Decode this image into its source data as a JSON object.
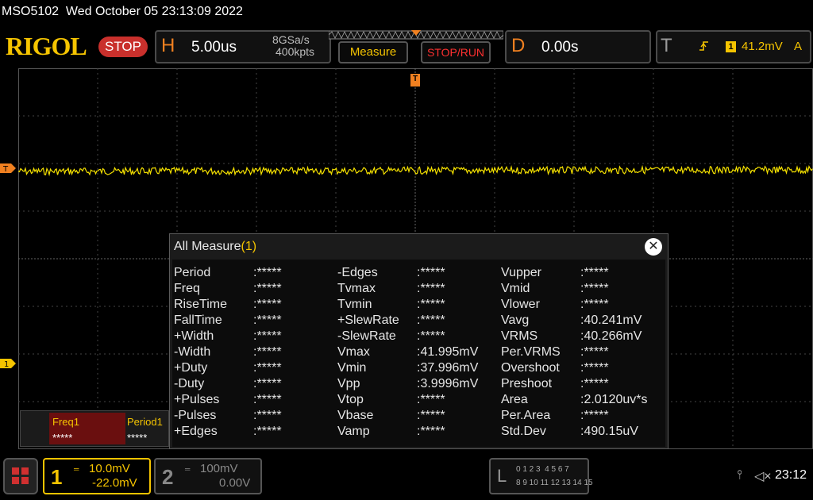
{
  "titlebar": {
    "title": "MSO5102  Wed October 05 23:13:09 2022"
  },
  "toolbar": {
    "logo": "RIGOL",
    "run_state": "STOP",
    "horizontal": {
      "letter": "H",
      "timebase": "5.00us",
      "sample_rate": "8GSa/s",
      "memory_depth": "400kpts"
    },
    "measure_label": "Measure",
    "stoprun_label": "STOP/RUN",
    "delay": {
      "letter": "D",
      "value": "0.00s"
    },
    "trigger": {
      "letter": "T",
      "source": "1",
      "level": "41.2mV",
      "mode": "A",
      "slope_icon": "rising-edge-icon"
    }
  },
  "markers": {
    "trigger_position": "T",
    "trigger_level": "T",
    "ch1_ground": "1"
  },
  "measure_panel": {
    "title": "All Measure",
    "count": "(1)",
    "columns": [
      [
        {
          "name": "Period",
          "value": ":*****"
        },
        {
          "name": "Freq",
          "value": ":*****"
        },
        {
          "name": "RiseTime",
          "value": ":*****"
        },
        {
          "name": "FallTime",
          "value": ":*****"
        },
        {
          "name": "+Width",
          "value": ":*****"
        },
        {
          "name": "-Width",
          "value": ":*****"
        },
        {
          "name": "+Duty",
          "value": ":*****"
        },
        {
          "name": "-Duty",
          "value": ":*****"
        },
        {
          "name": "+Pulses",
          "value": ":*****"
        },
        {
          "name": "-Pulses",
          "value": ":*****"
        },
        {
          "name": "+Edges",
          "value": ":*****"
        }
      ],
      [
        {
          "name": "-Edges",
          "value": ":*****"
        },
        {
          "name": "Tvmax",
          "value": ":*****"
        },
        {
          "name": "Tvmin",
          "value": ":*****"
        },
        {
          "name": "+SlewRate",
          "value": ":*****"
        },
        {
          "name": "-SlewRate",
          "value": ":*****"
        },
        {
          "name": "Vmax",
          "value": ":41.995mV"
        },
        {
          "name": "Vmin",
          "value": ":37.996mV"
        },
        {
          "name": "Vpp",
          "value": ":3.9996mV"
        },
        {
          "name": "Vtop",
          "value": ":*****"
        },
        {
          "name": "Vbase",
          "value": ":*****"
        },
        {
          "name": "Vamp",
          "value": ":*****"
        }
      ],
      [
        {
          "name": "Vupper",
          "value": ":*****"
        },
        {
          "name": "Vmid",
          "value": ":*****"
        },
        {
          "name": "Vlower",
          "value": ":*****"
        },
        {
          "name": "Vavg",
          "value": ":40.241mV"
        },
        {
          "name": "VRMS",
          "value": ":40.266mV"
        },
        {
          "name": "Per.VRMS",
          "value": ":*****"
        },
        {
          "name": "Overshoot",
          "value": ":*****"
        },
        {
          "name": "Preshoot",
          "value": ":*****"
        },
        {
          "name": "Area",
          "value": ":2.0120uv*s"
        },
        {
          "name": "Per.Area",
          "value": ":*****"
        },
        {
          "name": "Std.Dev",
          "value": ":490.15uV"
        }
      ]
    ]
  },
  "quick_measure": {
    "freq": {
      "label": "Freq1",
      "value": "*****"
    },
    "period": {
      "label": "Period1",
      "value": "*****"
    }
  },
  "channels": {
    "ch1": {
      "number": "1",
      "scale": "10.0mV",
      "offset": "-22.0mV",
      "color": "#f5c400"
    },
    "ch2": {
      "number": "2",
      "scale": "100mV",
      "offset": "0.00V",
      "color": "#888888"
    }
  },
  "logic_analyzer": {
    "letter": "L",
    "row1": "0 1 2 3  4 5 6 7",
    "row2": "8 9 10 11 12 13 14 15"
  },
  "status": {
    "clock": "23:12"
  },
  "colors": {
    "accent": "#f5c400",
    "orange": "#f08020",
    "stop": "#c9302c"
  }
}
